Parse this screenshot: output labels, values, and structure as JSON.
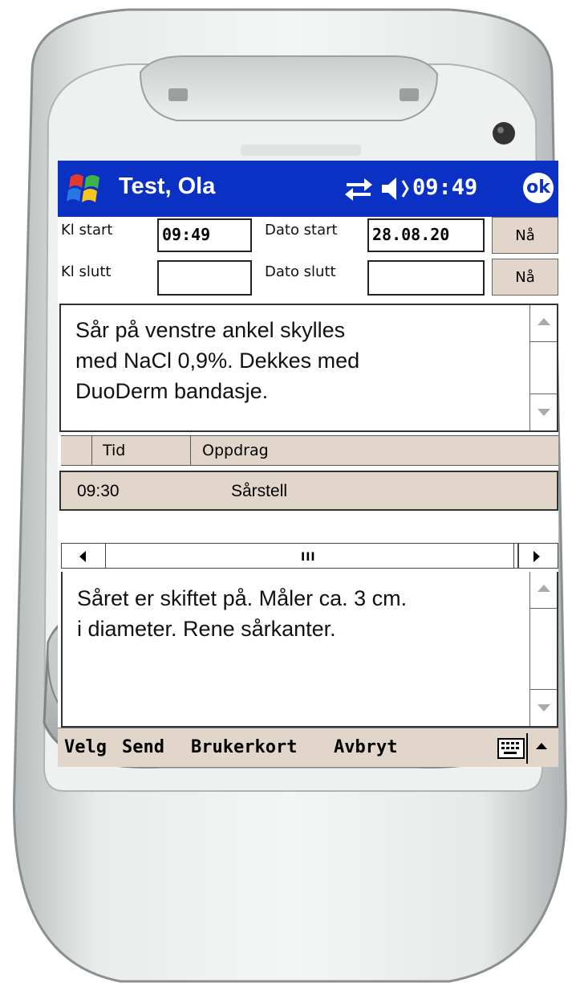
{
  "titlebar": {
    "title": "Test, Ola",
    "clock": "09:49",
    "ok_label": "ok"
  },
  "form": {
    "kl_start_label": "Kl start",
    "kl_start_value": "09:49",
    "dato_start_label": "Dato start",
    "dato_start_value": "28.08.20",
    "kl_slutt_label": "Kl slutt",
    "kl_slutt_value": "",
    "dato_slutt_label": "Dato slutt",
    "dato_slutt_value": "",
    "na_label": "Nå"
  },
  "note1": "Sår på venstre ankel skylles\nmed NaCl 0,9%.  Dekkes med\nDuoDerm bandasje.",
  "list": {
    "columns": [
      "Tid",
      "Oppdrag"
    ],
    "rows": [
      {
        "tid": "09:30",
        "oppdrag": "Sårstell"
      }
    ]
  },
  "note2": "Såret er skiftet på. Måler ca. 3 cm.\ni diameter. Rene sårkanter.",
  "menubar": {
    "items": [
      "Velg",
      "Send",
      "Brukerkort",
      "Avbryt"
    ]
  },
  "icons": {
    "start": "windows-flag-icon",
    "connectivity": "connectivity-icon",
    "volume": "speaker-icon",
    "keyboard": "keyboard-icon"
  },
  "colors": {
    "titlebar": "#0a30c4",
    "menubar": "#e2d6cb"
  }
}
